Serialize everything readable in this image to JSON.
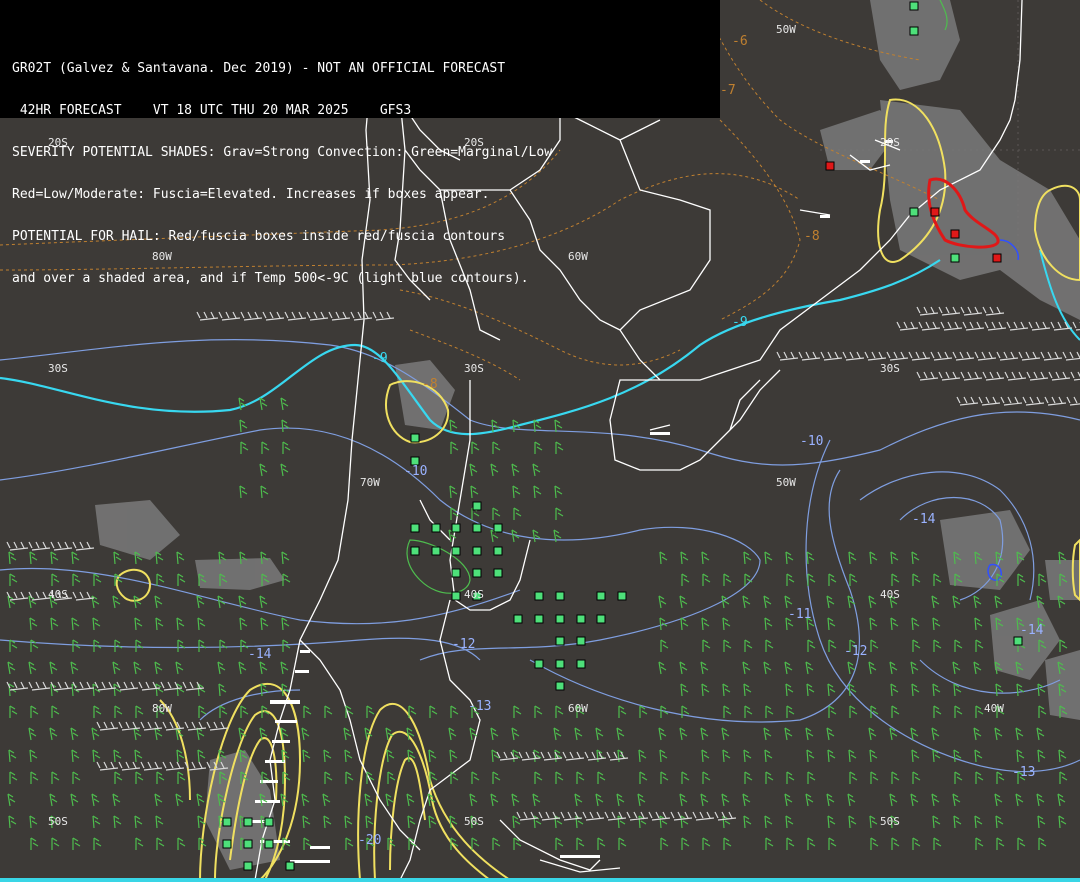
{
  "header": {
    "lines": [
      "GR02T (Galvez & Santavana. Dec 2019) - NOT AN OFFICIAL FORECAST",
      " 42HR FORECAST    VT 18 UTC THU 20 MAR 2025    GFS3",
      "SEVERITY POTENTIAL SHADES: Grav=Strong Convection: Green=Marginal/Low",
      "Red=Low/Moderate: Fuscia=Elevated. Increases if boxes appear.",
      "POTENTIAL FOR HAIL: Red/fuscia boxes inside red/fuscia contours",
      "and over a shaded area, and if Temp 500<-9C (light blue contours)."
    ]
  },
  "grid_labels": {
    "lat_20s": "20S",
    "lat_30s": "30S",
    "lat_40s": "40S",
    "lat_50s": "50S",
    "lon_80w": "80W",
    "lon_70w": "70W",
    "lon_60w": "60W",
    "lon_50w": "50W",
    "lon_40w": "40W"
  },
  "temp_labels": {
    "t_m6": "-6",
    "t_m7": "-7",
    "t_m8a": "-8",
    "t_m8b": "-8",
    "t_m9a": "-9",
    "t_m9b": "-9",
    "t_m10a": "-10",
    "t_m10b": "-10",
    "t_m11": "-11",
    "t_m12a": "-12",
    "t_m12b": "-12",
    "t_m13a": "-13",
    "t_m13b": "-13",
    "t_m14a": "-14",
    "t_m14b": "-14",
    "t_m14c": "-14",
    "t_m20": "-20"
  },
  "colors": {
    "background": "#3d3a37",
    "header_bg": "#000000",
    "coastline": "#ffffff",
    "contour_500_cold": "#38d8f0",
    "contour_500": "#7f9ee0",
    "contour_warm": "#c08030",
    "severity_gray": "#7a7a7a",
    "box_green": "#4ee07a",
    "box_red": "#e01818",
    "contour_yellow": "#f0e060",
    "wind_green": "#4ebd4e",
    "wind_white": "#d8d8d8"
  }
}
